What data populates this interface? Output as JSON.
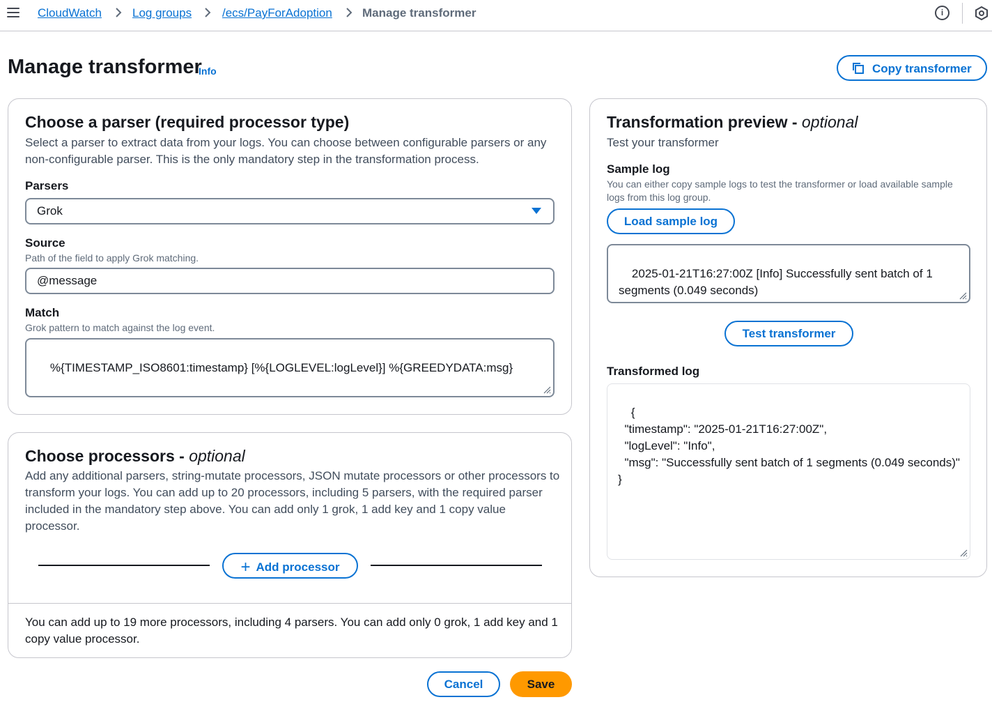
{
  "nav": {
    "breadcrumbs": [
      "CloudWatch",
      "Log groups",
      "/ecs/PayForAdoption"
    ],
    "current": "Manage transformer",
    "icons": [
      "menu-icon",
      "chevron-right-icon",
      "info-icon",
      "settings-hex-icon"
    ]
  },
  "header": {
    "title": "Manage transformer",
    "info_label": "Info",
    "copy_button": "Copy transformer"
  },
  "parser_panel": {
    "title": "Choose a parser (required processor type)",
    "description": "Select a parser to extract data from your logs. You can choose between configurable parsers or any non-configurable parser. This is the only mandatory step in the transformation process.",
    "parsers_label": "Parsers",
    "parsers_value": "Grok",
    "source_label": "Source",
    "source_hint": "Path of the field to apply Grok matching.",
    "source_value": "@message",
    "match_label": "Match",
    "match_hint": "Grok pattern to match against the log event.",
    "match_value": "%{TIMESTAMP_ISO8601:timestamp} [%{LOGLEVEL:logLevel}] %{GREEDYDATA:msg}"
  },
  "processors_panel": {
    "title": "Choose processors - ",
    "title_optional": "optional",
    "description": "Add any additional parsers, string-mutate processors, JSON mutate processors or other processors to transform your logs. You can add up to 20 processors, including 5 parsers, with the required parser included in the mandatory step above. You can add only 1 grok, 1 add key and 1 copy value processor.",
    "add_button": "Add processor",
    "footer_note": "You can add up to 19 more processors, including 4 parsers. You can add only 0 grok, 1 add key and 1 copy value processor."
  },
  "preview_panel": {
    "title": "Transformation preview - ",
    "title_optional": "optional",
    "subtitle": "Test your transformer",
    "sample_label": "Sample log",
    "sample_hint": "You can either copy sample logs to test the transformer or load available sample logs from this log group.",
    "load_button": "Load sample log",
    "sample_value": "2025-01-21T16:27:00Z [Info] Successfully sent batch of 1 segments (0.049 seconds)",
    "test_button": "Test transformer",
    "transformed_label": "Transformed log",
    "transformed_value": "{\n  \"timestamp\": \"2025-01-21T16:27:00Z\",\n  \"logLevel\": \"Info\",\n  \"msg\": \"Successfully sent batch of 1 segments (0.049 seconds)\"\n}"
  },
  "actions": {
    "cancel": "Cancel",
    "save": "Save"
  },
  "colors": {
    "link": "#0972d3",
    "primary": "#ff9900",
    "text": "#16191f",
    "muted": "#5f6b7a",
    "border": "#7d8998"
  }
}
